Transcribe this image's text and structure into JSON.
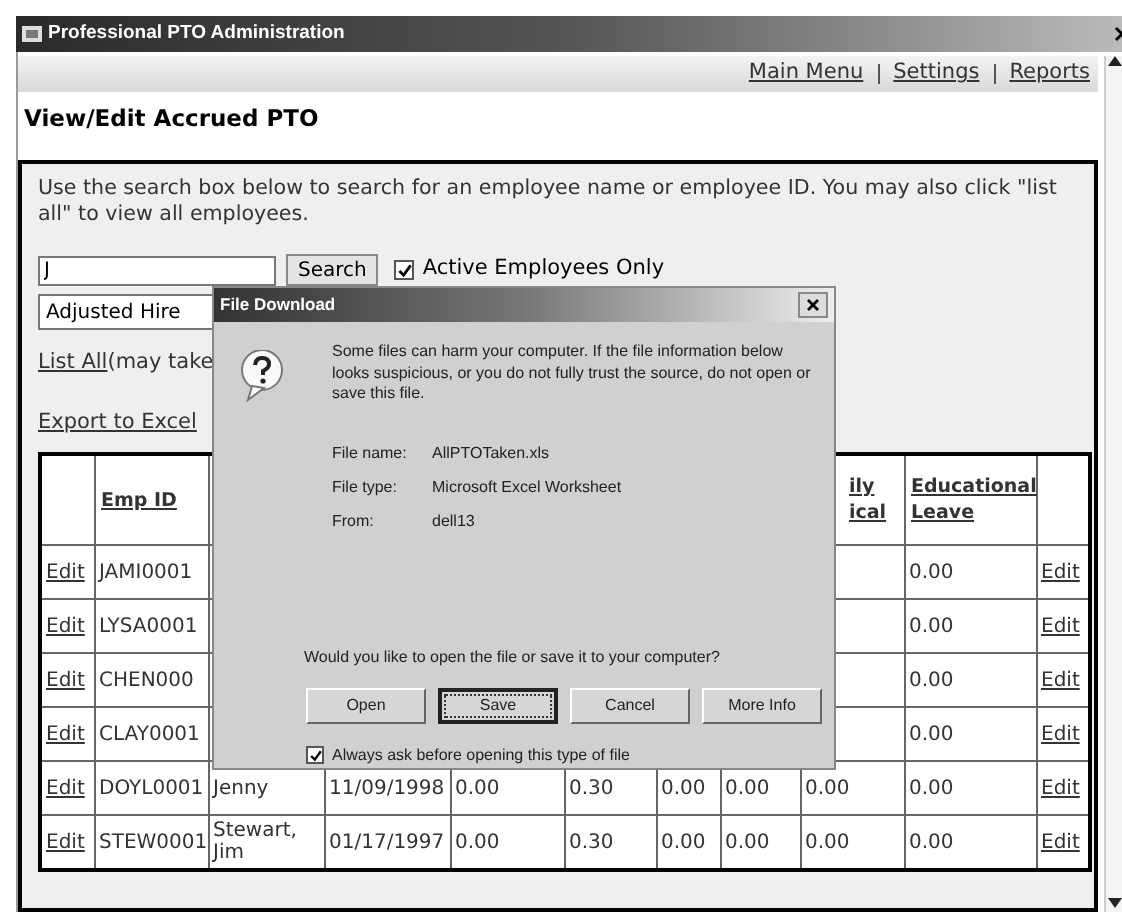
{
  "window": {
    "title": "Professional PTO Administration"
  },
  "nav": {
    "links": [
      "Main Menu",
      "Settings",
      "Reports"
    ]
  },
  "page_title": "View/Edit Accrued PTO",
  "instructions": "Use the search box below to search for an employee name or employee ID. You may also click \"list all\" to view all employees.",
  "search": {
    "value": "J",
    "button": "Search",
    "active_only": {
      "label": "Active Employees Only",
      "checked": true
    }
  },
  "sort_select": {
    "value": "Adjusted Hire"
  },
  "list_all": {
    "link": "List All",
    "note": "(may take"
  },
  "export_link": "Export to Excel",
  "table": {
    "header": {
      "emp_id": "Emp ID",
      "column_9": "ily ical",
      "educational_leave": "Educational Leave"
    },
    "rows": [
      {
        "edit": "Edit",
        "emp_id": "JAMI0001",
        "educational_leave": "0.00",
        "edit_right": "Edit"
      },
      {
        "edit": "Edit",
        "emp_id": "LYSA0001",
        "educational_leave": "0.00",
        "edit_right": "Edit"
      },
      {
        "edit": "Edit",
        "emp_id": "CHEN000",
        "educational_leave": "0.00",
        "edit_right": "Edit"
      },
      {
        "edit": "Edit",
        "emp_id": "CLAY0001",
        "educational_leave": "0.00",
        "edit_right": "Edit"
      },
      {
        "edit": "Edit",
        "emp_id": "DOYL0001",
        "name": "Jenny",
        "column_4": "11/09/1998",
        "column_5": "0.00",
        "column_6": "0.30",
        "column_7": "0.00",
        "column_8": "0.00",
        "column_9": "0.00",
        "educational_leave": "0.00",
        "edit_right": "Edit"
      },
      {
        "edit": "Edit",
        "emp_id": "STEW0001",
        "name": "Stewart, Jim",
        "column_4": "01/17/1997",
        "column_5": "0.00",
        "column_6": "0.30",
        "column_7": "0.00",
        "column_8": "0.00",
        "column_9": "0.00",
        "educational_leave": "0.00",
        "edit_right": "Edit"
      }
    ]
  },
  "dialog": {
    "title": "File Download",
    "message": "Some files can harm your computer. If the file information below looks suspicious, or you do not fully trust the source, do not open or save this file.",
    "fields": [
      {
        "label": "File name:",
        "value": "AllPTOTaken.xls"
      },
      {
        "label": "File type:",
        "value": "Microsoft Excel Worksheet"
      },
      {
        "label": "From:",
        "value": "dell13"
      }
    ],
    "question": "Would you like to open the file or save it to your computer?",
    "buttons": [
      {
        "label": "Open",
        "focused": false
      },
      {
        "label": "Save",
        "focused": true
      },
      {
        "label": "Cancel",
        "focused": false
      },
      {
        "label": "More Info",
        "focused": false
      }
    ],
    "always_ask": {
      "label": "Always ask before opening this type of file",
      "checked": true
    }
  }
}
